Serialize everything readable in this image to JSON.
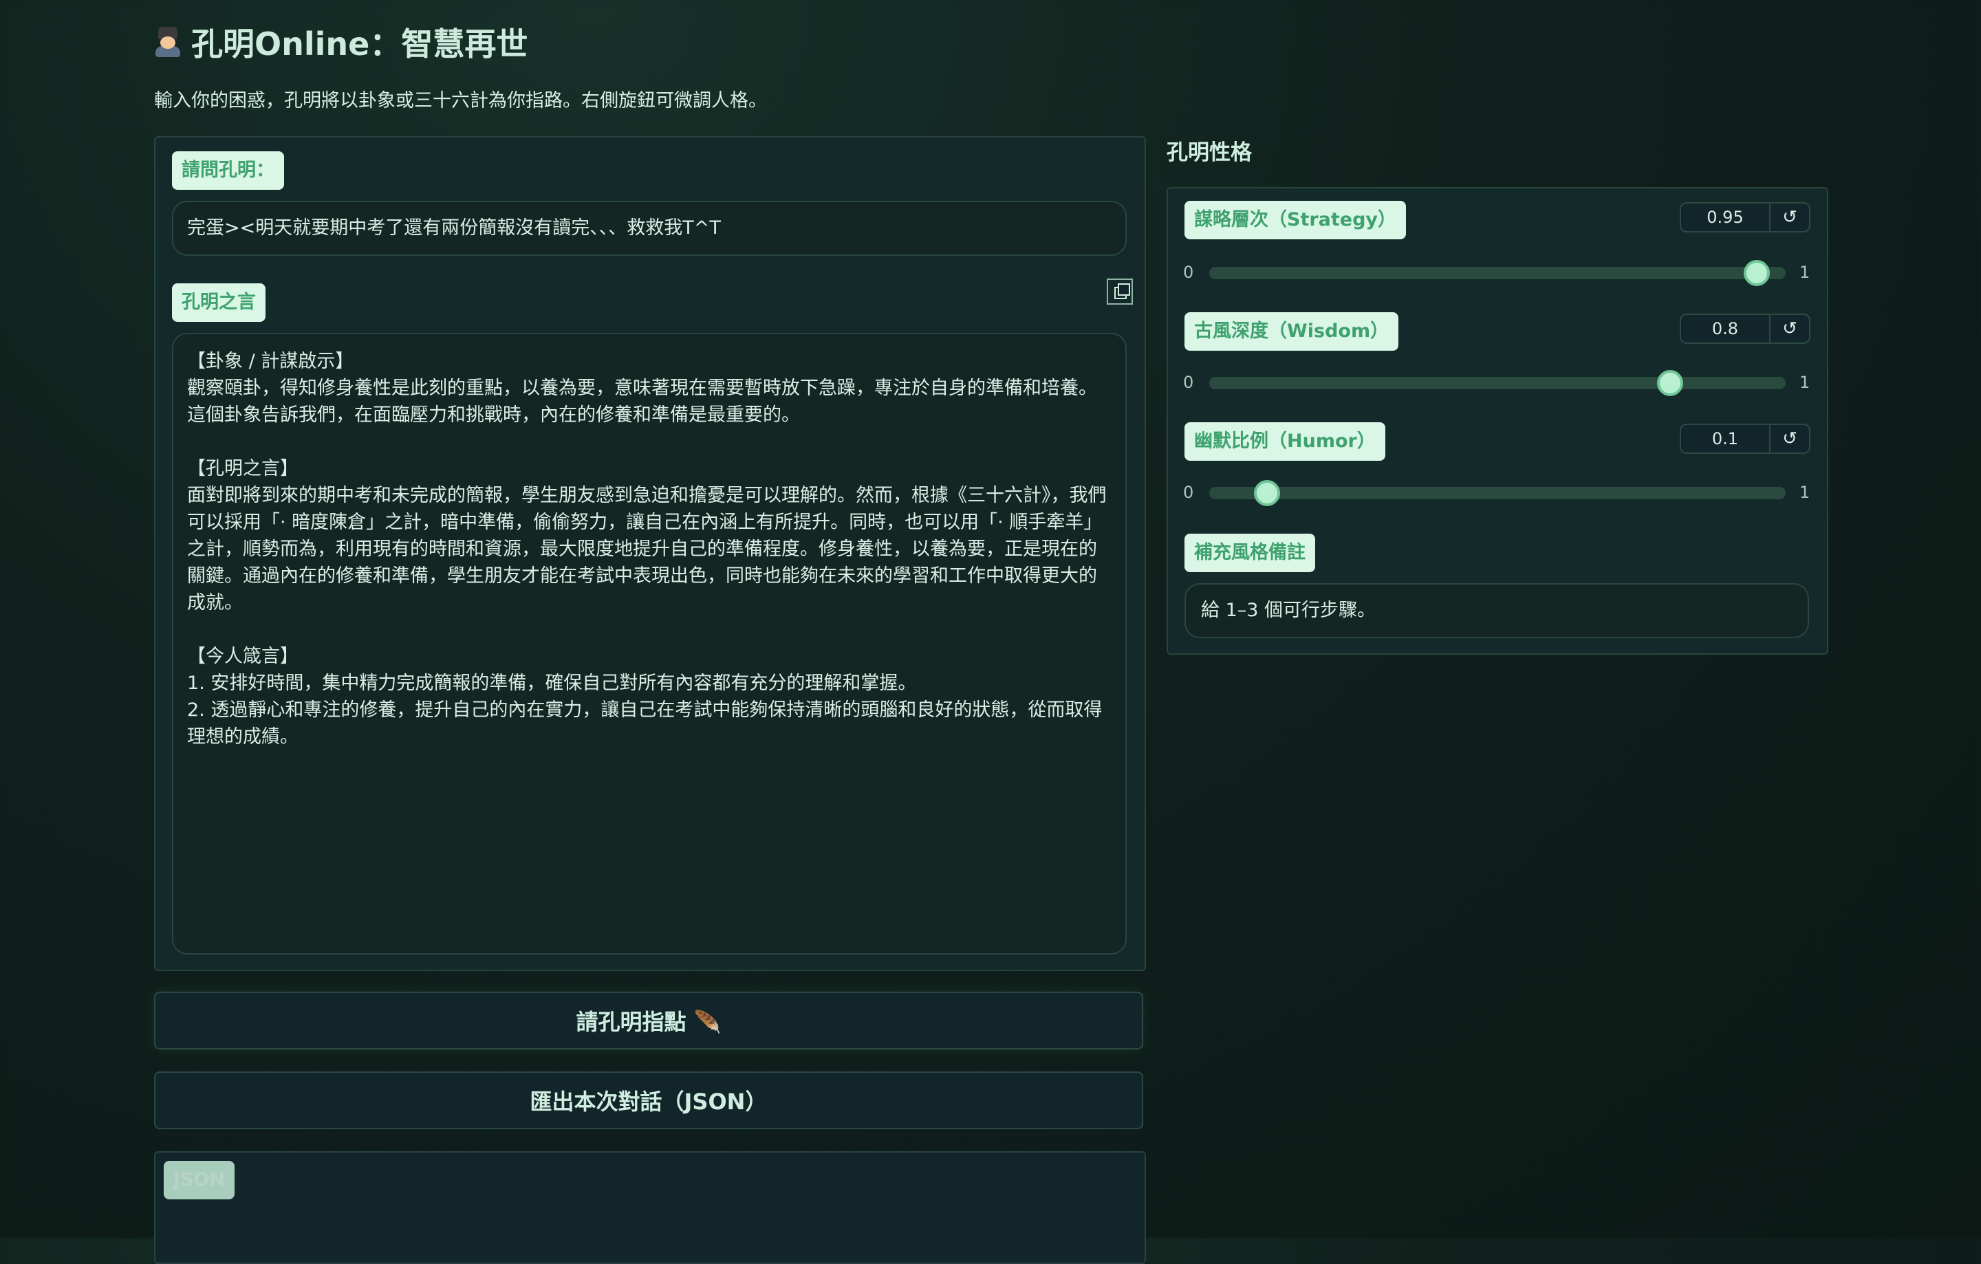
{
  "header": {
    "title": "孔明Online：智慧再世",
    "subtitle": "輸入你的困惑，孔明將以卦象或三十六計為你指路。右側旋鈕可微調人格。"
  },
  "question": {
    "label": "請問孔明：",
    "value": "完蛋><明天就要期中考了還有兩份簡報沒有讀完、、、救救我T^T"
  },
  "answer": {
    "label": "孔明之言",
    "text": "【卦象 / 計謀啟示】\n觀察頤卦，得知修身養性是此刻的重點，以養為要，意味著現在需要暫時放下急躁，專注於自身的準備和培養。這個卦象告訴我們，在面臨壓力和挑戰時，內在的修養和準備是最重要的。\n\n【孔明之言】\n面對即將到來的期中考和未完成的簡報，學生朋友感到急迫和擔憂是可以理解的。然而，根據《三十六計》，我們可以採用「· 暗度陳倉」之計，暗中準備，偷偷努力，讓自己在內涵上有所提升。同時，也可以用「· 順手牽羊」之計，順勢而為，利用現有的時間和資源，最大限度地提升自己的準備程度。修身養性，以養為要，正是現在的關鍵。通過內在的修養和準備，學生朋友才能在考試中表現出色，同時也能夠在未來的學習和工作中取得更大的成就。\n\n【今人箴言】\n1. 安排好時間，集中精力完成簡報的準備，確保自己對所有內容都有充分的理解和掌握。\n2. 透過靜心和專注的修養，提升自己的內在實力，讓自己在考試中能夠保持清晰的頭腦和良好的狀態，從而取得理想的成績。"
  },
  "buttons": {
    "ask": "請孔明指點 🪶",
    "export": "匯出本次對話（JSON）"
  },
  "json_panel": {
    "label": "JSON"
  },
  "personality": {
    "title": "孔明性格",
    "sliders": [
      {
        "label": "謀略層次（Strategy）",
        "value": 0.95,
        "display": "0.95",
        "min": "0",
        "max": "1"
      },
      {
        "label": "古風深度（Wisdom）",
        "value": 0.8,
        "display": "0.8",
        "min": "0",
        "max": "1"
      },
      {
        "label": "幽默比例（Humor）",
        "value": 0.1,
        "display": "0.1",
        "min": "0",
        "max": "1"
      }
    ],
    "note_label": "補充風格備註",
    "note_value": "給 1–3 個可行步驟。"
  },
  "colors": {
    "accent": "#3fa26e",
    "chip_bg": "#d9f6e6",
    "thumb": "#b9f0d2"
  }
}
